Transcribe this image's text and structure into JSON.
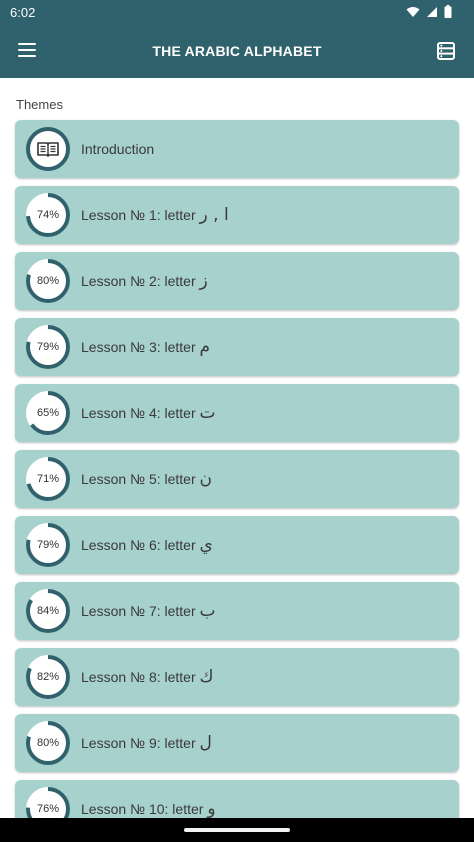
{
  "status": {
    "time": "6:02"
  },
  "header": {
    "title": "THE ARABIC ALPHABET",
    "menu_icon": "hamburger-menu-icon",
    "list_icon": "list-view-icon"
  },
  "colors": {
    "appbar": "#2f626c",
    "card": "#a7d1cd",
    "ring": "#2f626c",
    "ring_track": "#ffffff"
  },
  "section": {
    "label": "Themes"
  },
  "intro": {
    "label": "Introduction",
    "icon": "open-book-icon"
  },
  "lessons": [
    {
      "title": "Lesson № 1: letter ",
      "letter": "ا , ر",
      "progress": 74,
      "progress_label": "74%"
    },
    {
      "title": "Lesson № 2: letter ",
      "letter": "ز",
      "progress": 80,
      "progress_label": "80%"
    },
    {
      "title": "Lesson № 3: letter ",
      "letter": "م",
      "progress": 79,
      "progress_label": "79%"
    },
    {
      "title": "Lesson № 4: letter ",
      "letter": "ت",
      "progress": 65,
      "progress_label": "65%"
    },
    {
      "title": "Lesson № 5: letter ",
      "letter": "ن",
      "progress": 71,
      "progress_label": "71%"
    },
    {
      "title": "Lesson № 6: letter ",
      "letter": "ي",
      "progress": 79,
      "progress_label": "79%"
    },
    {
      "title": "Lesson № 7: letter ",
      "letter": "ب",
      "progress": 84,
      "progress_label": "84%"
    },
    {
      "title": "Lesson № 8: letter ",
      "letter": "ك",
      "progress": 82,
      "progress_label": "82%"
    },
    {
      "title": "Lesson № 9: letter ",
      "letter": "ل",
      "progress": 80,
      "progress_label": "80%"
    },
    {
      "title": "Lesson № 10: letter ",
      "letter": "و",
      "progress": 76,
      "progress_label": "76%"
    }
  ]
}
